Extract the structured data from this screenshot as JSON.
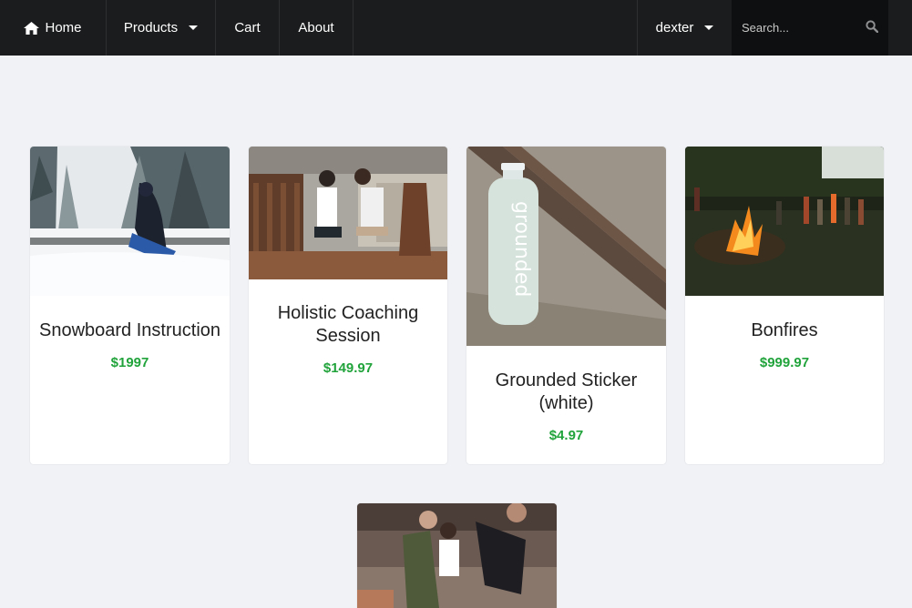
{
  "nav": {
    "home_label": "Home",
    "products_label": "Products",
    "cart_label": "Cart",
    "about_label": "About",
    "user_label": "dexter",
    "search_placeholder": "Search..."
  },
  "products": [
    {
      "title": "Snowboard Instruction",
      "price": "$1997"
    },
    {
      "title": "Holistic Coaching Session",
      "price": "$149.97"
    },
    {
      "title": "Grounded Sticker (white)",
      "price": "$4.97"
    },
    {
      "title": "Bonfires",
      "price": "$999.97"
    }
  ],
  "colors": {
    "navbar": "#1b1c1d",
    "background": "#f0f2f6",
    "price": "#21a33b"
  }
}
